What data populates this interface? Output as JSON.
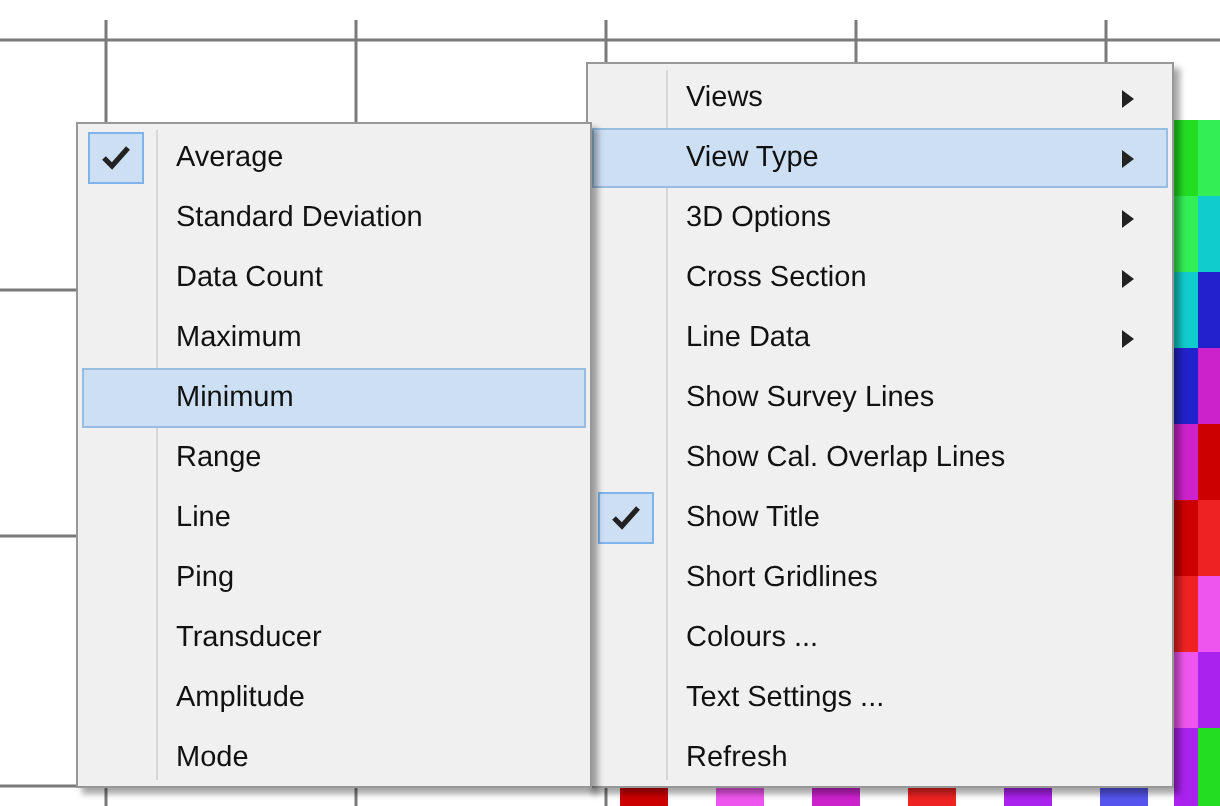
{
  "main_menu": {
    "items": [
      {
        "label": "Views",
        "submenu": true,
        "checked": false,
        "selected": false
      },
      {
        "label": "View Type",
        "submenu": true,
        "checked": false,
        "selected": true
      },
      {
        "label": "3D Options",
        "submenu": true,
        "checked": false,
        "selected": false
      },
      {
        "label": "Cross Section",
        "submenu": true,
        "checked": false,
        "selected": false
      },
      {
        "label": "Line Data",
        "submenu": true,
        "checked": false,
        "selected": false
      },
      {
        "label": "Show Survey Lines",
        "submenu": false,
        "checked": false,
        "selected": false
      },
      {
        "label": "Show Cal. Overlap Lines",
        "submenu": false,
        "checked": false,
        "selected": false
      },
      {
        "label": "Show Title",
        "submenu": false,
        "checked": true,
        "selected": false
      },
      {
        "label": "Short Gridlines",
        "submenu": false,
        "checked": false,
        "selected": false
      },
      {
        "label": "Colours ...",
        "submenu": false,
        "checked": false,
        "selected": false
      },
      {
        "label": "Text Settings ...",
        "submenu": false,
        "checked": false,
        "selected": false
      },
      {
        "label": "Refresh",
        "submenu": false,
        "checked": false,
        "selected": false
      }
    ]
  },
  "view_type_submenu": {
    "items": [
      {
        "label": "Average",
        "submenu": false,
        "checked": true,
        "selected": false
      },
      {
        "label": "Standard Deviation",
        "submenu": false,
        "checked": false,
        "selected": false
      },
      {
        "label": "Data Count",
        "submenu": false,
        "checked": false,
        "selected": false
      },
      {
        "label": "Maximum",
        "submenu": false,
        "checked": false,
        "selected": false
      },
      {
        "label": "Minimum",
        "submenu": false,
        "checked": false,
        "selected": true
      },
      {
        "label": "Range",
        "submenu": false,
        "checked": false,
        "selected": false
      },
      {
        "label": "Line",
        "submenu": false,
        "checked": false,
        "selected": false
      },
      {
        "label": "Ping",
        "submenu": false,
        "checked": false,
        "selected": false
      },
      {
        "label": "Transducer",
        "submenu": false,
        "checked": false,
        "selected": false
      },
      {
        "label": "Amplitude",
        "submenu": false,
        "checked": false,
        "selected": false
      },
      {
        "label": "Mode",
        "submenu": false,
        "checked": false,
        "selected": false
      }
    ]
  }
}
